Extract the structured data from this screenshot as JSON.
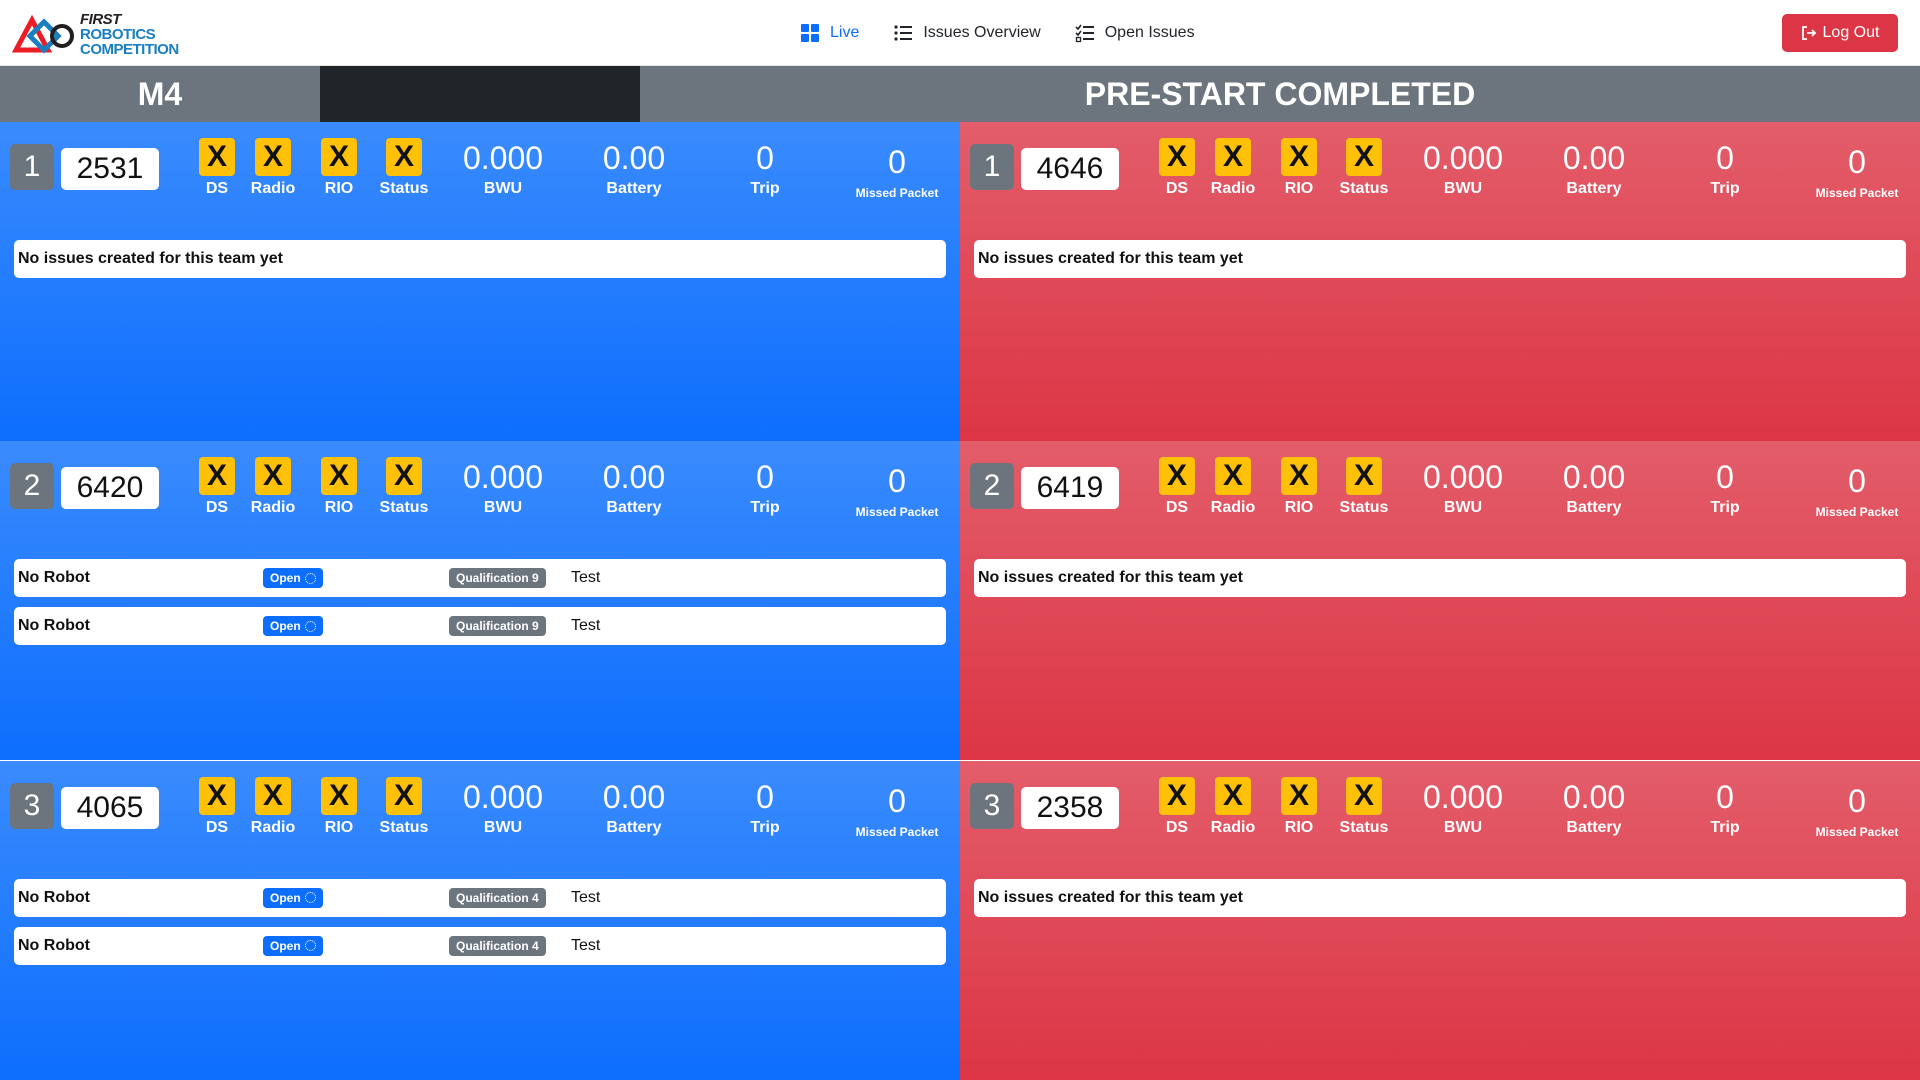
{
  "nav": {
    "logo": {
      "line1": "FIRST",
      "line2": "ROBOTICS",
      "line3": "COMPETITION"
    },
    "links": [
      {
        "label": "Live",
        "icon": "grid-icon",
        "active": true
      },
      {
        "label": "Issues Overview",
        "icon": "list-icon",
        "active": false
      },
      {
        "label": "Open Issues",
        "icon": "checklist-icon",
        "active": false
      }
    ],
    "logout_label": "Log Out"
  },
  "match": {
    "name": "M4",
    "status": "PRE-START COMPLETED"
  },
  "labels": {
    "ds": "DS",
    "radio": "Radio",
    "rio": "RIO",
    "status": "Status",
    "bwu": "BWU",
    "battery": "Battery",
    "trip": "Trip",
    "missed": "Missed Packet",
    "x": "X",
    "no_issues": "No issues created for this team yet"
  },
  "blue": [
    {
      "station": "1",
      "team": "2531",
      "bwu": "0.000",
      "battery": "0.00",
      "trip": "0",
      "missed": "0",
      "issues": []
    },
    {
      "station": "2",
      "team": "6420",
      "bwu": "0.000",
      "battery": "0.00",
      "trip": "0",
      "missed": "0",
      "issues": [
        {
          "title": "No Robot",
          "state": "Open",
          "match": "Qualification 9",
          "desc": "Test"
        },
        {
          "title": "No Robot",
          "state": "Open",
          "match": "Qualification 9",
          "desc": "Test"
        }
      ]
    },
    {
      "station": "3",
      "team": "4065",
      "bwu": "0.000",
      "battery": "0.00",
      "trip": "0",
      "missed": "0",
      "issues": [
        {
          "title": "No Robot",
          "state": "Open",
          "match": "Qualification 4",
          "desc": "Test"
        },
        {
          "title": "No Robot",
          "state": "Open",
          "match": "Qualification 4",
          "desc": "Test"
        }
      ]
    }
  ],
  "red": [
    {
      "station": "1",
      "team": "4646",
      "bwu": "0.000",
      "battery": "0.00",
      "trip": "0",
      "missed": "0",
      "issues": []
    },
    {
      "station": "2",
      "team": "6419",
      "bwu": "0.000",
      "battery": "0.00",
      "trip": "0",
      "missed": "0",
      "issues": []
    },
    {
      "station": "3",
      "team": "2358",
      "bwu": "0.000",
      "battery": "0.00",
      "trip": "0",
      "missed": "0",
      "issues": []
    }
  ]
}
